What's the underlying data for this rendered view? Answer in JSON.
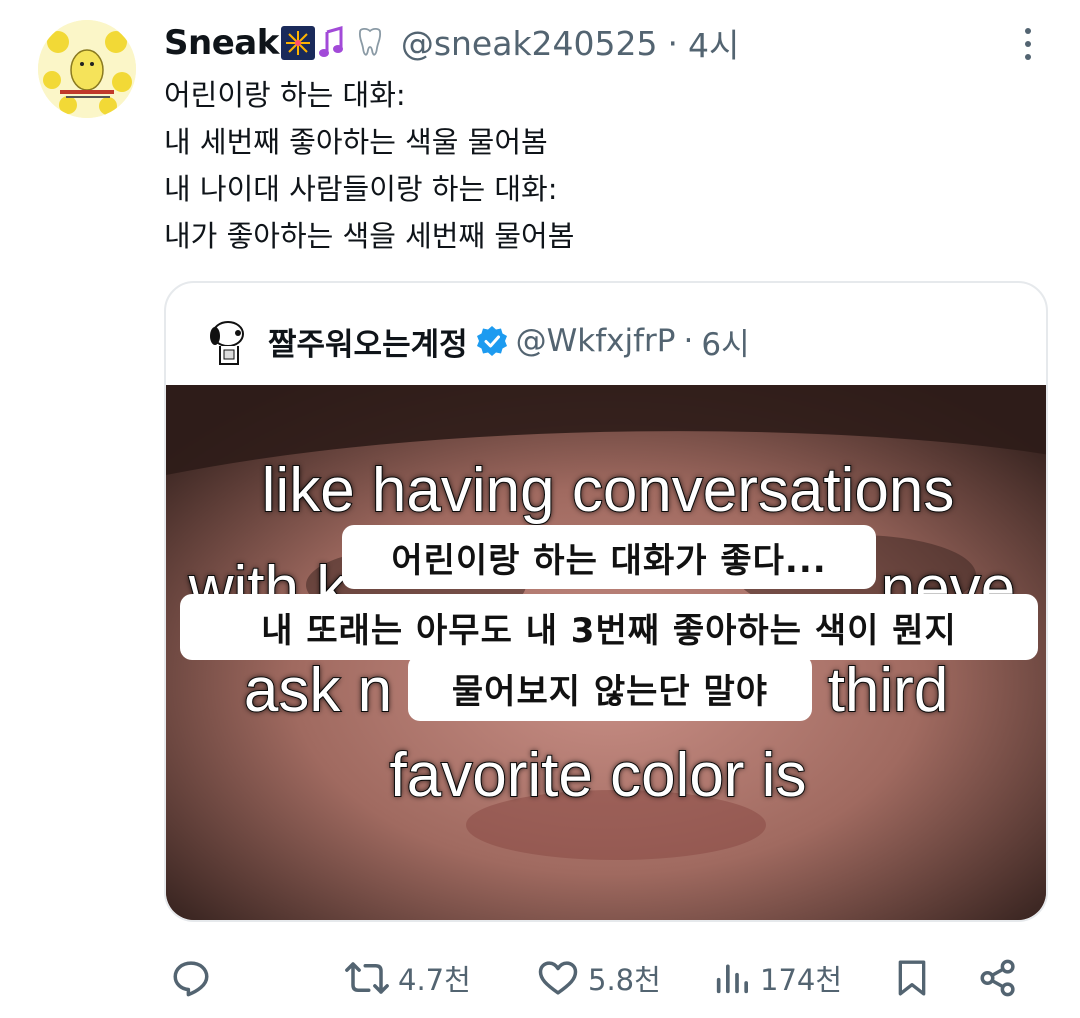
{
  "tweet": {
    "display_name": "Sneak",
    "name_emoji": [
      "fireworks-icon",
      "music-notes-icon",
      "tooth-icon"
    ],
    "handle": "@sneak240525",
    "separator": "·",
    "time": "4시",
    "text_lines": [
      "어린이랑 하는 대화:",
      "내 세번째 좋아하는 색울 물어봄",
      "내 나이대 사람들이랑 하는 대화:",
      "내가 좋아하는 색을 세번째 물어봄"
    ]
  },
  "quote": {
    "display_name": "짤주워오는계정",
    "handle": "@WkfxjfrP",
    "separator": "·",
    "time": "6시",
    "media": {
      "english_lines": [
        "like having conversations",
        "with k",
        "neve",
        "ask n",
        "third",
        "favorite color is"
      ],
      "subtitles": [
        "어린이랑 하는 대화가 좋다...",
        "내 또래는 아무도 내 3번째 좋아하는 색이 뭔지",
        "물어보지 않는단 말야"
      ]
    }
  },
  "actions": {
    "reply_count": "",
    "retweet_count": "4.7천",
    "like_count": "5.8천",
    "views_count": "174천"
  },
  "colors": {
    "text": "#0f1419",
    "secondary": "#536471",
    "verified": "#1d9bf0",
    "border": "#e6e9ec"
  }
}
